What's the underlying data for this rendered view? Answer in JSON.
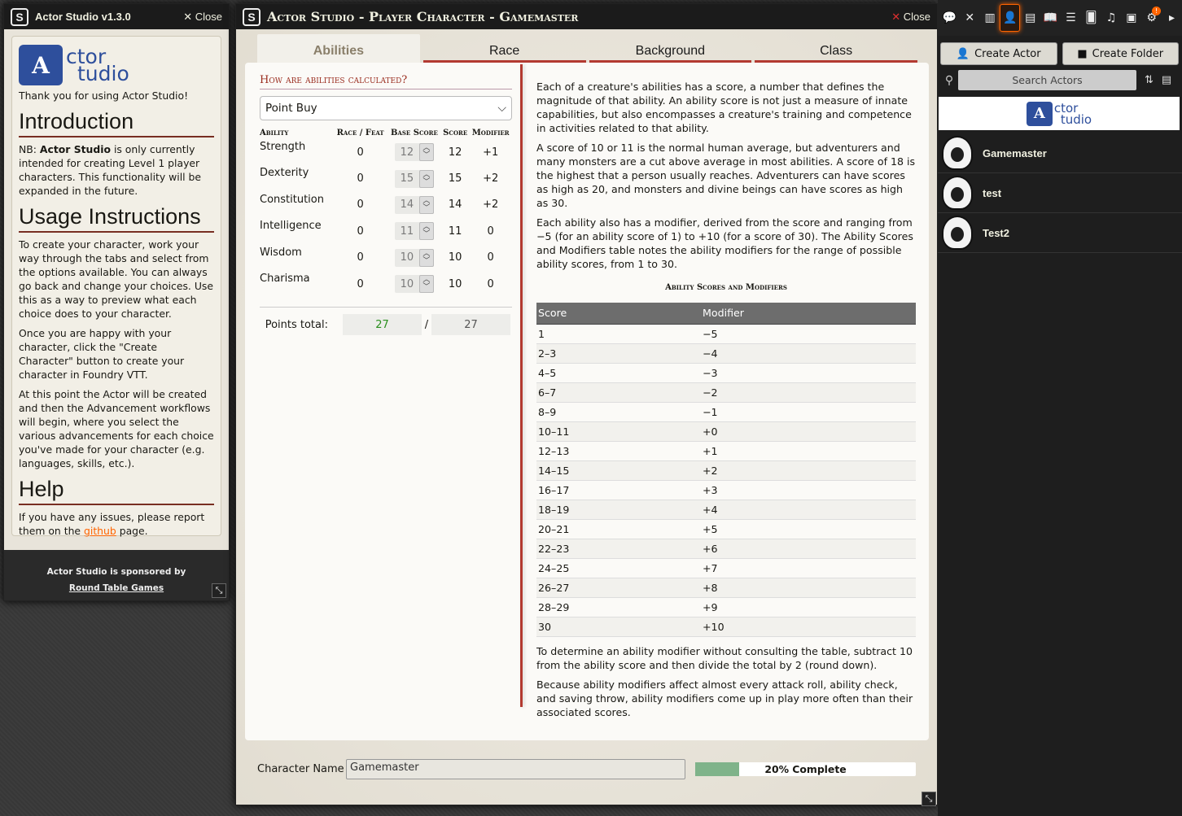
{
  "left_window": {
    "title": "Actor Studio v1.3.0",
    "close_label": "Close",
    "logo_line1": "ctor",
    "logo_line2": "tudio",
    "thanks": "Thank you for using Actor Studio!",
    "intro_heading": "Introduction",
    "intro_nb": "NB:",
    "intro_bold": "Actor Studio",
    "intro_text": "is only currently intended for creating Level 1 player characters. This functionality will be expanded in the future.",
    "usage_heading": "Usage Instructions",
    "usage_p1": "To create your character, work your way through the tabs and select from the options available. You can always go back and change your choices. Use this as a way to preview what each choice does to your character.",
    "usage_p2": "Once you are happy with your character, click the \"Create Character\" button to create your character in Foundry VTT.",
    "usage_p3": "At this point the Actor will be created and then the Advancement workflows will begin, where you select the various advancements for each choice you've made for your character (e.g. languages, skills, etc.).",
    "help_heading": "Help",
    "help_text_before": "If you have any issues, please report them on the",
    "help_link": "github",
    "help_text_after": "page.",
    "sponsor_line": "Actor Studio is sponsored by",
    "sponsor_link": "Round Table Games"
  },
  "main_window": {
    "title": "Actor Studio - Player Character - Gamemaster",
    "close_label": "Close",
    "tabs": [
      {
        "label": "Abilities",
        "active": true
      },
      {
        "label": "Race",
        "active": false
      },
      {
        "label": "Background",
        "active": false
      },
      {
        "label": "Class",
        "active": false
      }
    ],
    "calc_question": "How are abilities calculated?",
    "calc_method": "Point Buy",
    "ability_headers": {
      "ability": "Ability",
      "race": "Race / Feat",
      "base": "Base Score",
      "score": "Score",
      "modifier": "Modifier"
    },
    "abilities": [
      {
        "name": "Strength",
        "race": "0",
        "base": "12",
        "score": "12",
        "mod": "+1"
      },
      {
        "name": "Dexterity",
        "race": "0",
        "base": "15",
        "score": "15",
        "mod": "+2"
      },
      {
        "name": "Constitution",
        "race": "0",
        "base": "14",
        "score": "14",
        "mod": "+2"
      },
      {
        "name": "Intelligence",
        "race": "0",
        "base": "11",
        "score": "11",
        "mod": "0"
      },
      {
        "name": "Wisdom",
        "race": "0",
        "base": "10",
        "score": "10",
        "mod": "0"
      },
      {
        "name": "Charisma",
        "race": "0",
        "base": "10",
        "score": "10",
        "mod": "0"
      }
    ],
    "points_label": "Points total:",
    "points_used": "27",
    "points_sep": "/",
    "points_max": "27",
    "desc_p1": "Each of a creature's abilities has a score, a number that defines the magnitude of that ability. An ability score is not just a measure of innate capabilities, but also encompasses a creature's training and competence in activities related to that ability.",
    "desc_p2": "A score of 10 or 11 is the normal human average, but adventurers and many monsters are a cut above average in most abilities. A score of 18 is the highest that a person usually reaches. Adventurers can have scores as high as 20, and monsters and divine beings can have scores as high as 30.",
    "desc_p3": "Each ability also has a modifier, derived from the score and ranging from −5 (for an ability score of 1) to +10 (for a score of 30). The Ability Scores and Modifiers table notes the ability modifiers for the range of possible ability scores, from 1 to 30.",
    "table_title": "Ability Scores and Modifiers",
    "table_headers": {
      "score": "Score",
      "modifier": "Modifier"
    },
    "table_rows": [
      {
        "score": "1",
        "mod": "−5"
      },
      {
        "score": "2–3",
        "mod": "−4"
      },
      {
        "score": "4–5",
        "mod": "−3"
      },
      {
        "score": "6–7",
        "mod": "−2"
      },
      {
        "score": "8–9",
        "mod": "−1"
      },
      {
        "score": "10–11",
        "mod": "+0"
      },
      {
        "score": "12–13",
        "mod": "+1"
      },
      {
        "score": "14–15",
        "mod": "+2"
      },
      {
        "score": "16–17",
        "mod": "+3"
      },
      {
        "score": "18–19",
        "mod": "+4"
      },
      {
        "score": "20–21",
        "mod": "+5"
      },
      {
        "score": "22–23",
        "mod": "+6"
      },
      {
        "score": "24–25",
        "mod": "+7"
      },
      {
        "score": "26–27",
        "mod": "+8"
      },
      {
        "score": "28–29",
        "mod": "+9"
      },
      {
        "score": "30",
        "mod": "+10"
      }
    ],
    "desc_p4": "To determine an ability modifier without consulting the table, subtract 10 from the ability score and then divide the total by 2 (round down).",
    "desc_p5": "Because ability modifiers affect almost every attack roll, ability check, and saving throw, ability modifiers come up in play more often than their associated scores.",
    "char_name_label": "Character Name",
    "char_name_value": "Gamemaster",
    "progress_percent": 20,
    "progress_text": "20% Complete"
  },
  "sidebar": {
    "tabs": [
      {
        "icon": "chat-icon",
        "glyph": "💬"
      },
      {
        "icon": "combat-icon",
        "glyph": "✕"
      },
      {
        "icon": "scenes-icon",
        "glyph": "▥"
      },
      {
        "icon": "actors-icon",
        "glyph": "👤",
        "active": true
      },
      {
        "icon": "items-icon",
        "glyph": "▤"
      },
      {
        "icon": "journal-icon",
        "glyph": "📖"
      },
      {
        "icon": "tables-icon",
        "glyph": "☰"
      },
      {
        "icon": "cards-icon",
        "glyph": "🂠"
      },
      {
        "icon": "playlists-icon",
        "glyph": "♫"
      },
      {
        "icon": "compendium-icon",
        "glyph": "▣"
      },
      {
        "icon": "settings-icon",
        "glyph": "⚙",
        "badge": "!"
      },
      {
        "icon": "collapse-icon",
        "glyph": "▸"
      }
    ],
    "create_actor": "Create Actor",
    "create_folder": "Create Folder",
    "search_placeholder": "Search Actors",
    "banner_line1": "ctor",
    "banner_line2": "tudio",
    "actors": [
      "Gamemaster",
      "test",
      "Test2"
    ]
  }
}
